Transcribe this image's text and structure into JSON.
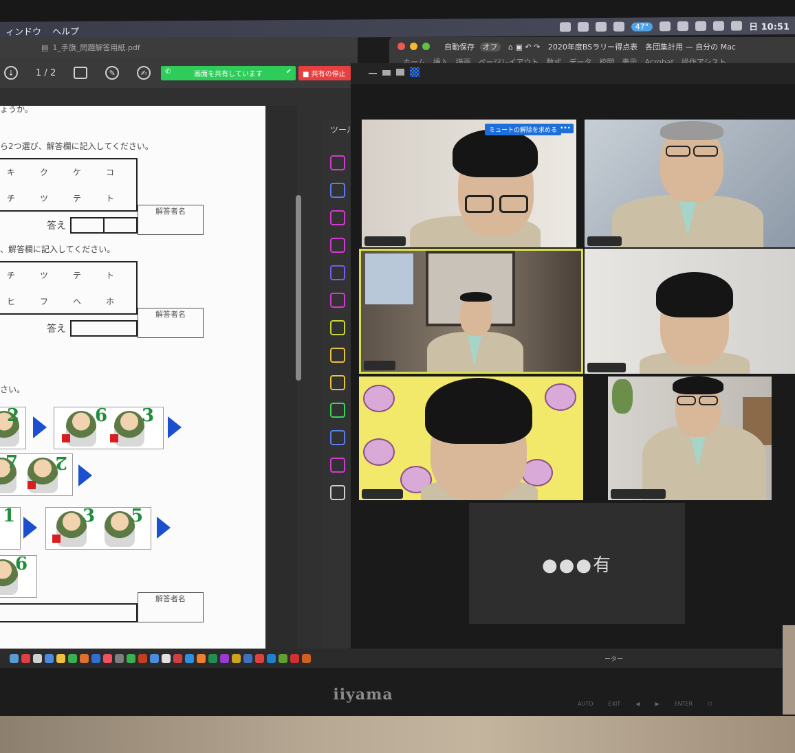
{
  "menubar": {
    "items": [
      "ィンドウ",
      "ヘルプ"
    ],
    "temperature": "47°",
    "clock": "日 10:51"
  },
  "pdf": {
    "title": "1_手旗_問題解答用紙.pdf",
    "page_current": "1",
    "page_sep": "/",
    "page_total": "2",
    "share_status": "画面を共有しています",
    "stop_share": "共有の停止",
    "tools_label": "ツール",
    "question_tail": "ょうか。",
    "instruction_1": "ら2つ選び、解答欄に記入してください。",
    "row1": [
      "キ",
      "ク",
      "ケ",
      "コ"
    ],
    "row2": [
      "チ",
      "ツ",
      "テ",
      "ト"
    ],
    "answerer_label": "解答者名",
    "answer_label": "答え",
    "instruction_2": "、解答欄に記入してください。",
    "row3": [
      "チ",
      "ツ",
      "テ",
      "ト"
    ],
    "row4": [
      "ヒ",
      "フ",
      "ヘ",
      "ホ"
    ],
    "instruction_3": "さい。",
    "numbers": [
      "2",
      "6",
      "3",
      "7",
      "2",
      "1",
      "3",
      "5",
      "6"
    ]
  },
  "excel": {
    "autosave": "自動保存",
    "autosave_state": "オフ",
    "doc_title": "2020年度BSラリー得点表　各団集計用 — 自分の Mac",
    "menu": "ホーム　挿入　描画　ページレイアウト　数式　データ　校閲　表示　Acrobat　操作アシスト"
  },
  "zoom": {
    "unmute_request": "ミュートの解除を求める",
    "more": "•••",
    "speaker_name": "●●●有"
  },
  "dock": {
    "label": "ーター"
  },
  "monitor": {
    "brand": "iiyama",
    "controls": [
      "AUTO",
      "EXIT",
      "◀",
      "▶",
      "ENTER",
      "⏻"
    ]
  }
}
